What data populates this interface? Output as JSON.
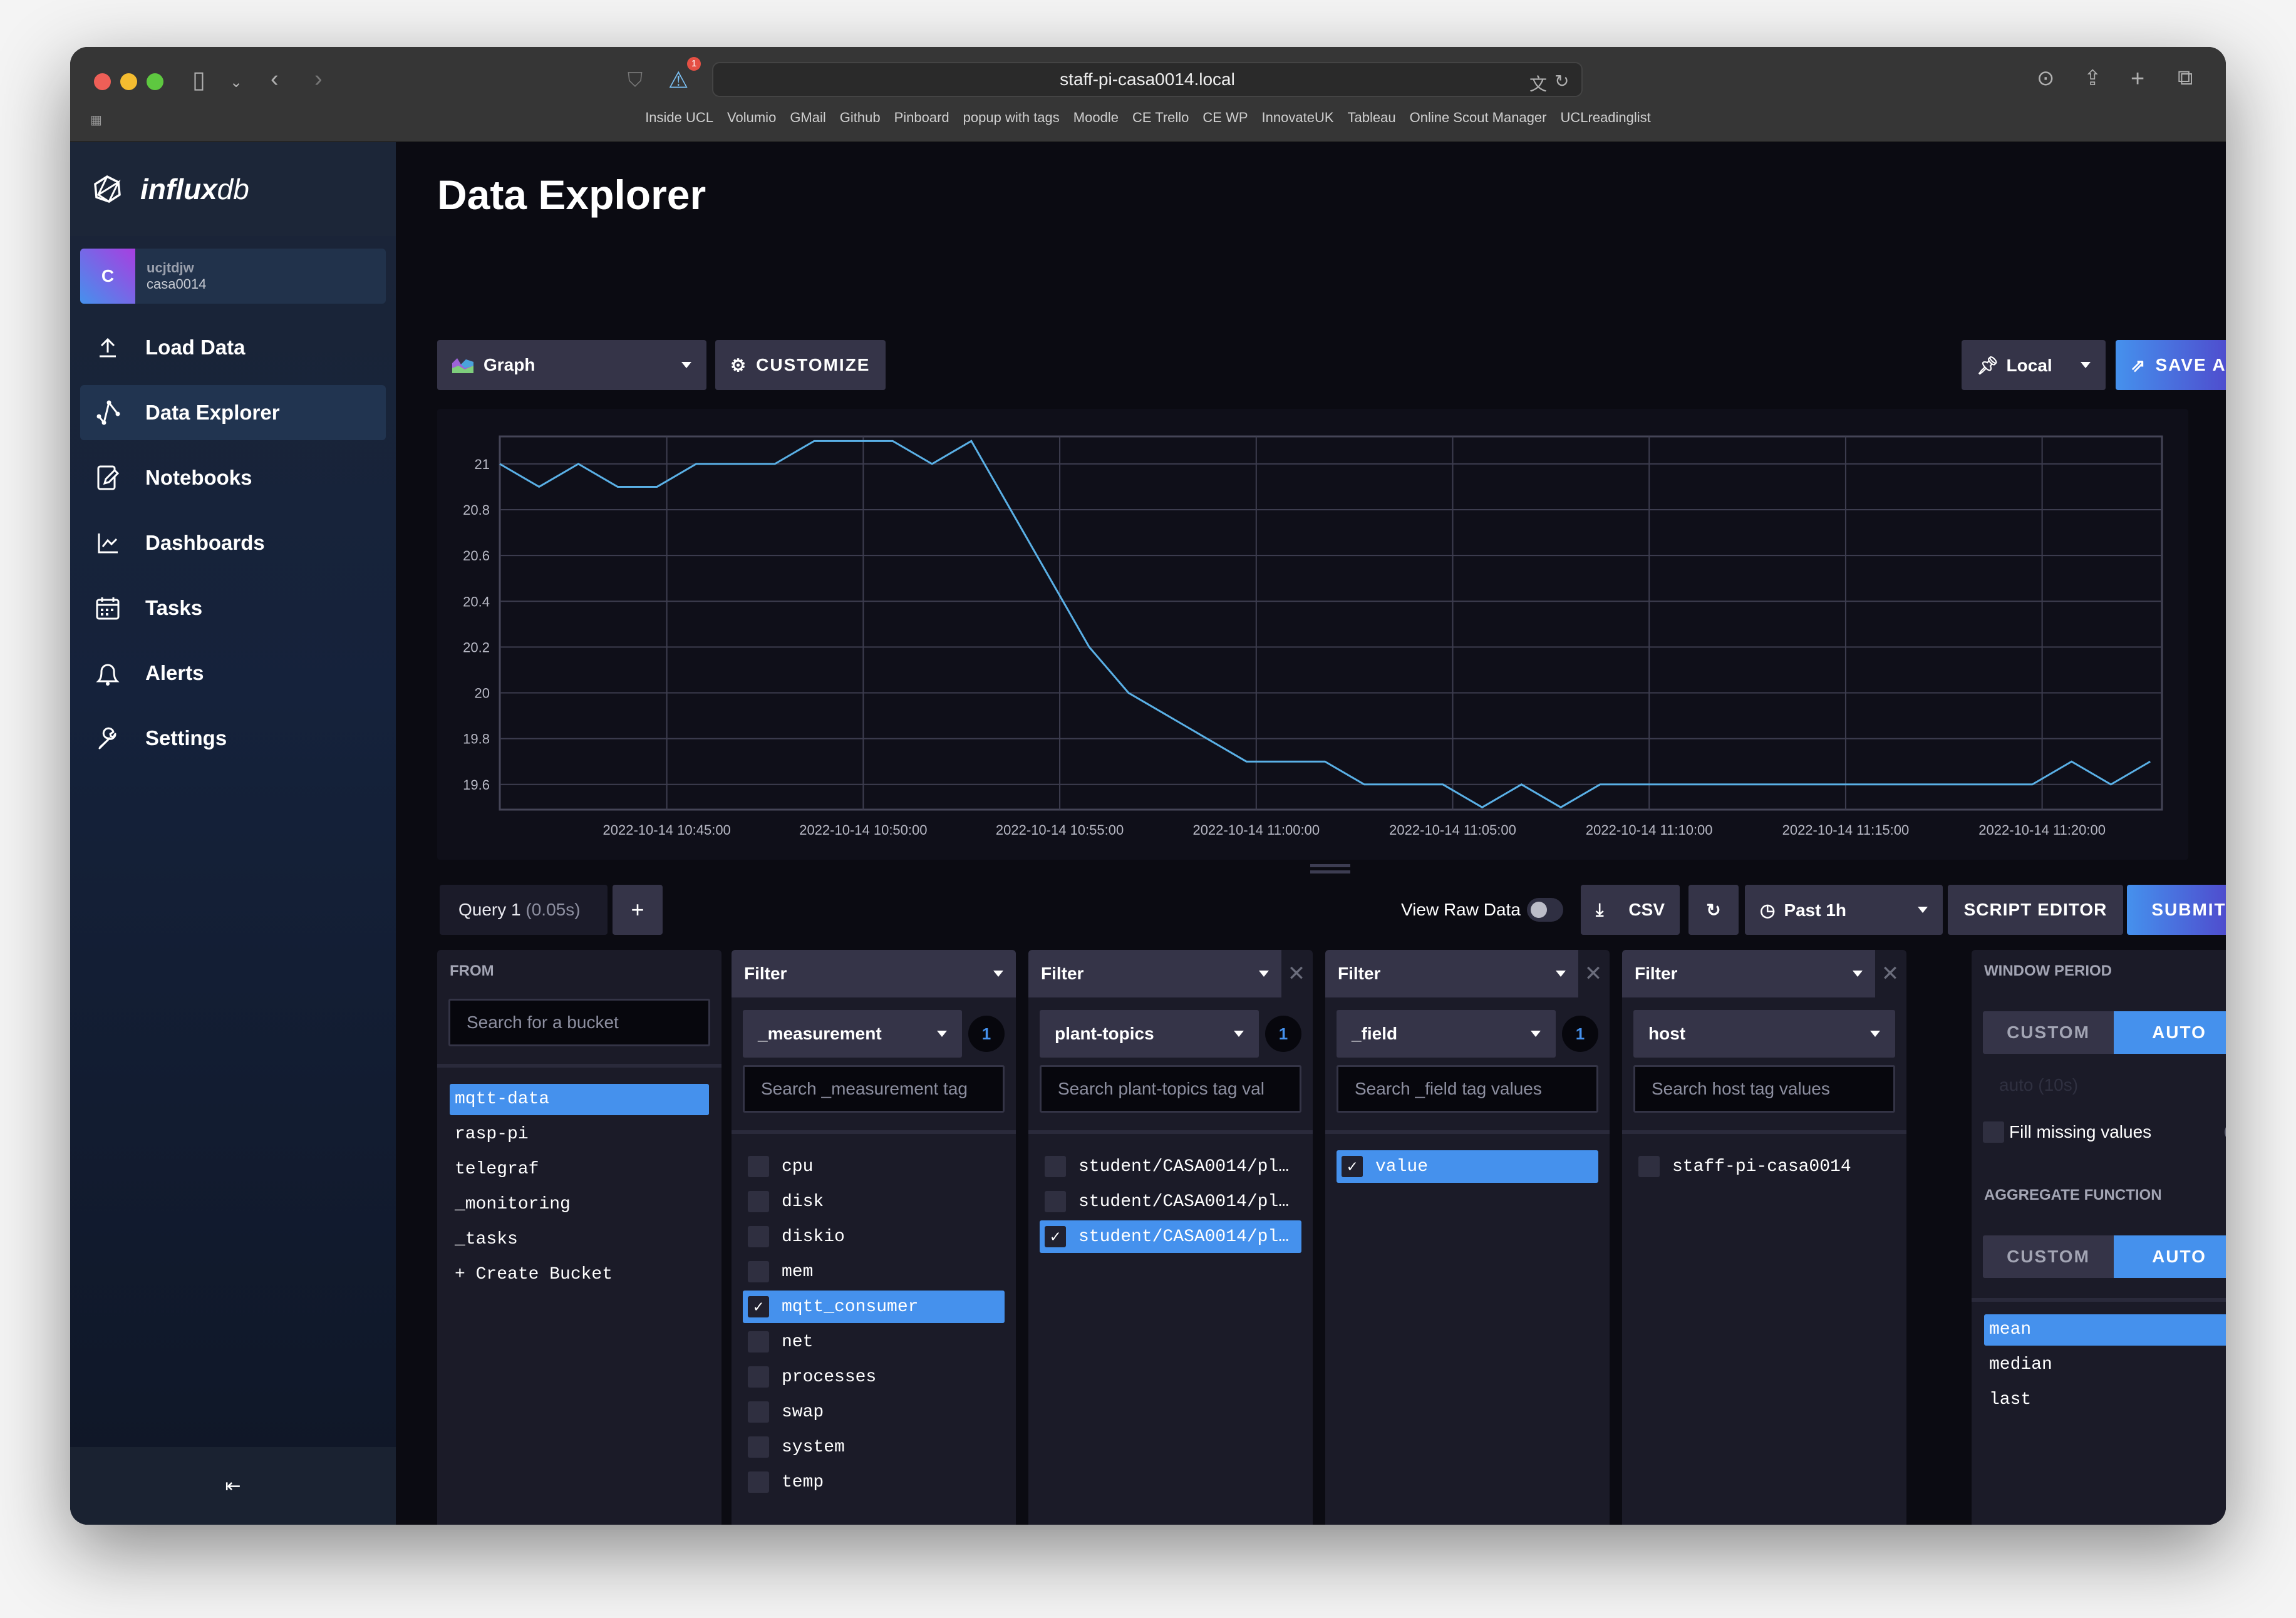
{
  "browser": {
    "url": "staff-pi-casa0014.local",
    "alert_badge": "1",
    "bookmarks": [
      "Inside UCL",
      "Volumio",
      "GMail",
      "Github",
      "Pinboard",
      "popup with tags",
      "Moodle",
      "CE Trello",
      "CE WP",
      "InnovateUK",
      "Tableau",
      "Online Scout Manager",
      "UCLreadinglist"
    ]
  },
  "sidebar": {
    "logo_bold": "influx",
    "logo_light": "db",
    "org": {
      "avatar_letter": "C",
      "user": "ucjtdjw",
      "org": "casa0014"
    },
    "items": [
      {
        "label": "Load Data",
        "icon": "upload-icon"
      },
      {
        "label": "Data Explorer",
        "icon": "graph-icon",
        "active": true
      },
      {
        "label": "Notebooks",
        "icon": "notebook-icon"
      },
      {
        "label": "Dashboards",
        "icon": "dashboard-icon"
      },
      {
        "label": "Tasks",
        "icon": "calendar-icon"
      },
      {
        "label": "Alerts",
        "icon": "bell-icon"
      },
      {
        "label": "Settings",
        "icon": "wrench-icon"
      }
    ],
    "collapse_icon": "collapse-sidebar-icon"
  },
  "header": {
    "title": "Data Explorer",
    "graph_type": "Graph",
    "customize": "CUSTOMIZE",
    "timezone": "Local",
    "save_as": "SAVE AS"
  },
  "chart_data": {
    "type": "line",
    "title": "",
    "xlabel": "",
    "ylabel": "",
    "ylim": [
      19.49,
      21.12
    ],
    "yticks": [
      "19.6",
      "19.8",
      "20",
      "20.2",
      "20.4",
      "20.6",
      "20.8",
      "21"
    ],
    "ytick_values": [
      19.6,
      19.8,
      20.0,
      20.2,
      20.4,
      20.6,
      20.8,
      21.0
    ],
    "xticks": [
      "2022-10-14 10:45:00",
      "2022-10-14 10:50:00",
      "2022-10-14 10:55:00",
      "2022-10-14 11:00:00",
      "2022-10-14 11:05:00",
      "2022-10-14 11:10:00",
      "2022-10-14 11:15:00",
      "2022-10-14 11:20:00"
    ],
    "x_start_minutes_before_first_tick": 4.25,
    "x_step_minutes": 1,
    "x_range_minutes": [
      0,
      42.3
    ],
    "grid": true,
    "series": [
      {
        "name": "value",
        "color": "#5ab0e6",
        "values": [
          21.0,
          20.9,
          21.0,
          20.9,
          20.9,
          21.0,
          21.0,
          21.0,
          21.1,
          21.1,
          21.1,
          21.0,
          21.1,
          20.8,
          20.5,
          20.2,
          20.0,
          19.9,
          19.8,
          19.7,
          19.7,
          19.7,
          19.6,
          19.6,
          19.6,
          19.5,
          19.6,
          19.5,
          19.6,
          19.6,
          19.6,
          19.6,
          19.6,
          19.6,
          19.6,
          19.6,
          19.6,
          19.6,
          19.6,
          19.6,
          19.7,
          19.6,
          19.7
        ]
      }
    ]
  },
  "query": {
    "tab_label": "Query 1",
    "tab_time": "(0.05s)",
    "add": "+",
    "view_raw": "View Raw Data",
    "csv": "CSV",
    "time_range": "Past 1h",
    "script_editor": "SCRIPT EDITOR",
    "submit": "SUBMIT"
  },
  "from": {
    "title": "FROM",
    "search_placeholder": "Search for a bucket",
    "buckets": [
      {
        "name": "mqtt-data",
        "selected": true
      },
      {
        "name": "rasp-pi"
      },
      {
        "name": "telegraf"
      },
      {
        "name": "_monitoring"
      },
      {
        "name": "_tasks"
      },
      {
        "name": "+ Create Bucket"
      }
    ]
  },
  "filters": [
    {
      "head": "Filter",
      "key": "_measurement",
      "count": "1",
      "search": "Search _measurement tag",
      "closable": false,
      "values": [
        {
          "v": "cpu"
        },
        {
          "v": "disk"
        },
        {
          "v": "diskio"
        },
        {
          "v": "mem"
        },
        {
          "v": "mqtt_consumer",
          "sel": true
        },
        {
          "v": "net"
        },
        {
          "v": "processes"
        },
        {
          "v": "swap"
        },
        {
          "v": "system"
        },
        {
          "v": "temp"
        }
      ]
    },
    {
      "head": "Filter",
      "key": "plant-topics",
      "count": "1",
      "search": "Search plant-topics tag val",
      "closable": true,
      "values": [
        {
          "v": "student/CASA0014/pl…"
        },
        {
          "v": "student/CASA0014/pl…"
        },
        {
          "v": "student/CASA0014/pl…",
          "sel": true
        }
      ]
    },
    {
      "head": "Filter",
      "key": "_field",
      "count": "1",
      "search": "Search _field tag values",
      "closable": true,
      "values": [
        {
          "v": "value",
          "sel": true
        }
      ]
    },
    {
      "head": "Filter",
      "key": "host",
      "count": "",
      "search": "Search host tag values",
      "closable": true,
      "values": [
        {
          "v": "staff-pi-casa0014"
        }
      ]
    }
  ],
  "window_period": {
    "title": "WINDOW PERIOD",
    "custom": "CUSTOM",
    "auto": "AUTO",
    "auto_value": "auto (10s)",
    "fill_missing": "Fill missing values",
    "help": "?"
  },
  "aggregate": {
    "title": "AGGREGATE FUNCTION",
    "custom": "CUSTOM",
    "auto": "AUTO",
    "functions": [
      {
        "name": "mean",
        "selected": true
      },
      {
        "name": "median"
      },
      {
        "name": "last"
      }
    ]
  }
}
